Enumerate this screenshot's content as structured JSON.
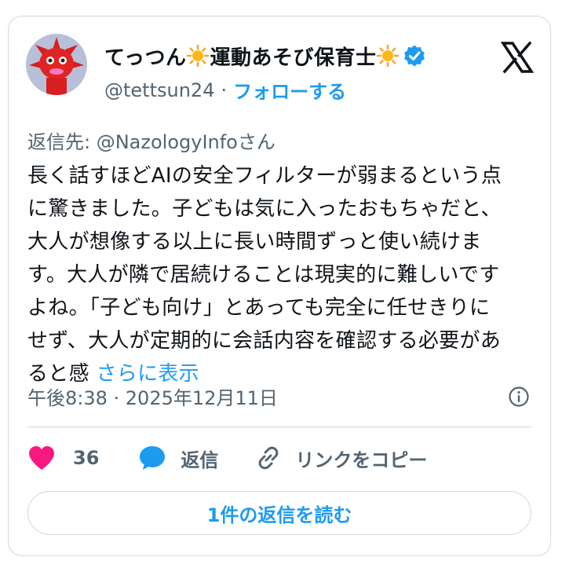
{
  "author": {
    "name_part1": "てっつん",
    "name_part2": "運動あそび保育士",
    "handle": "@tettsun24",
    "separator": "·",
    "follow_label": "フォローする",
    "verified": true,
    "avatar_icon": "red-character-avatar"
  },
  "tweet": {
    "reply_to": "返信先: @NazologyInfoさん",
    "text_lines": [
      "長く話すほどAIの安全フィルターが弱まるという点",
      "に驚きました。子どもは気に入ったおもちゃだと、",
      "大人が想像する以上に長い時間ずっと使い続けま",
      "す。大人が隣で居続けることは現実的に難しいです",
      "よね。「子ども向け」とあっても完全に任せきりに",
      "せず、大人が定期的に会話内容を確認する必要があ",
      "ると感"
    ],
    "show_more": "さらに表示",
    "timestamp": "午後8:38 · 2025年12月11日"
  },
  "actions": {
    "like_count": "36",
    "reply_label": "返信",
    "copy_link_label": "リンクをコピー"
  },
  "read_replies_label": "1件の返信を読む",
  "colors": {
    "accent": "#1d9bf0",
    "like": "#f91880",
    "muted": "#536471",
    "border": "#cfd9de",
    "text": "#0f1419"
  }
}
